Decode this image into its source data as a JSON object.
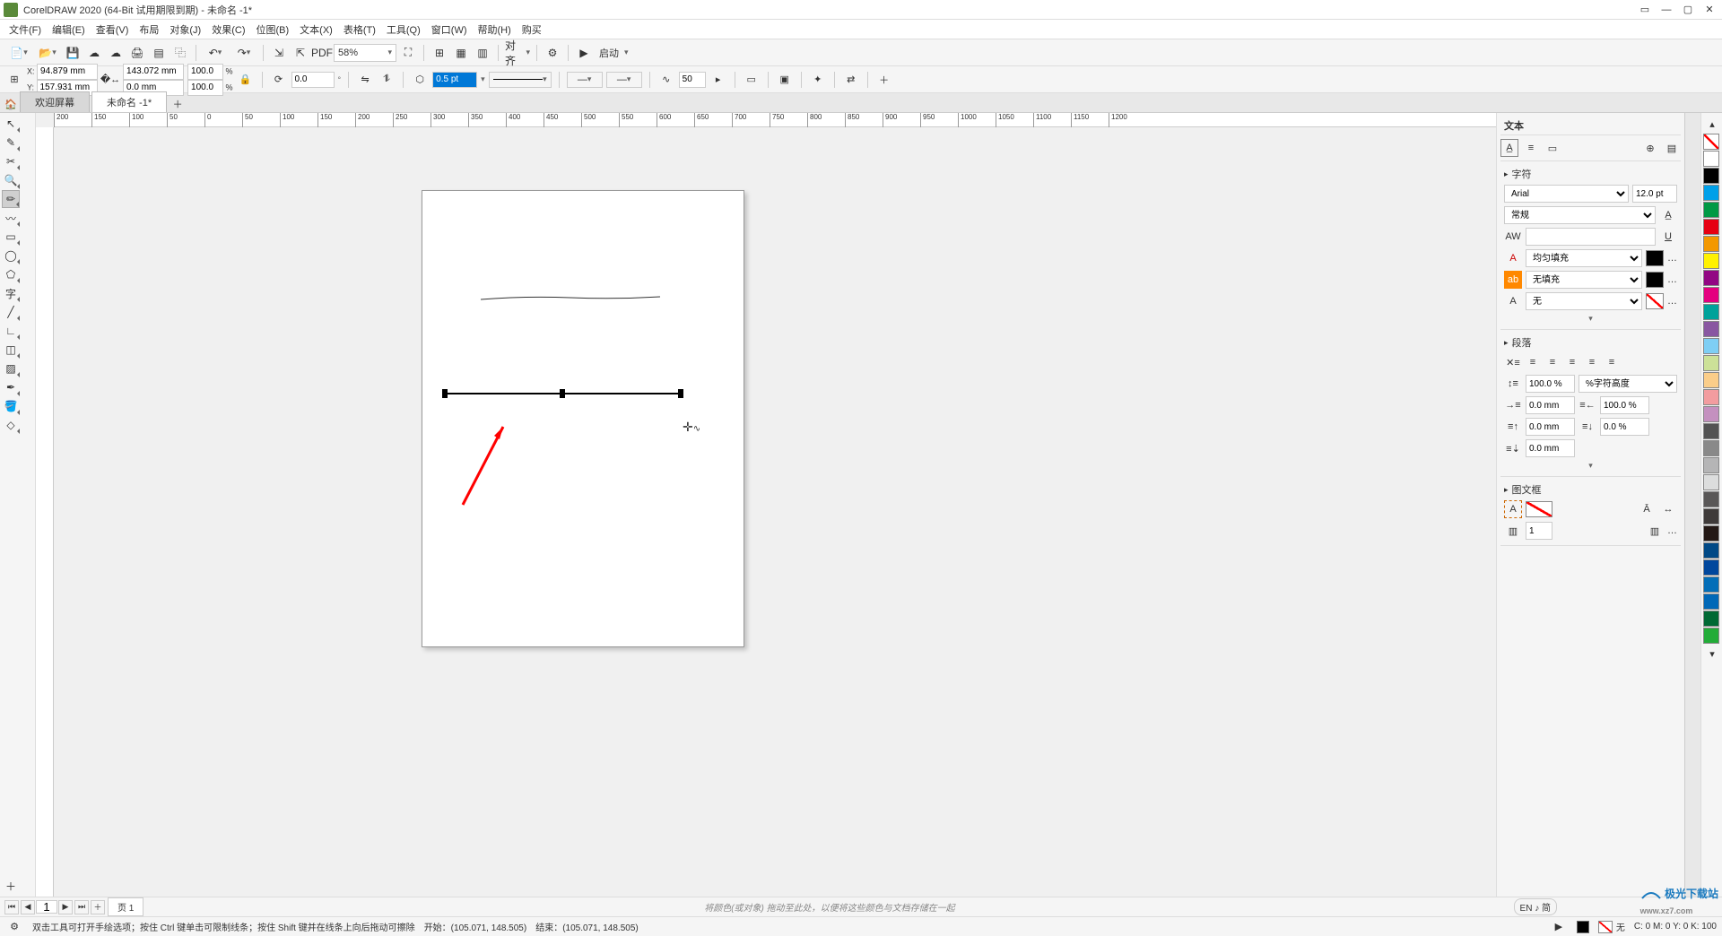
{
  "app": {
    "title": "CorelDRAW 2020 (64-Bit 试用期限到期) - 未命名 -1*"
  },
  "menu": {
    "items": [
      "文件(F)",
      "编辑(E)",
      "查看(V)",
      "布局",
      "对象(J)",
      "效果(C)",
      "位图(B)",
      "文本(X)",
      "表格(T)",
      "工具(Q)",
      "窗口(W)",
      "帮助(H)",
      "购买"
    ]
  },
  "toolbar1": {
    "zoom": "58%",
    "launch_label": "启动"
  },
  "propbar": {
    "x": "94.879 mm",
    "y": "157.931 mm",
    "w": "143.072 mm",
    "h": "0.0 mm",
    "sx": "100.0",
    "sy": "100.0",
    "rot": "0.0",
    "outline_width": "0.5 pt",
    "freehand_smoothing": "50"
  },
  "tabs": {
    "welcome": "欢迎屏幕",
    "doc": "未命名 -1*"
  },
  "ruler_ticks": [
    "200",
    "150",
    "100",
    "50",
    "0",
    "50",
    "100",
    "150",
    "200",
    "250",
    "300",
    "350",
    "400",
    "450",
    "500",
    "550",
    "600",
    "650",
    "700",
    "750",
    "800",
    "850",
    "900",
    "950",
    "1000",
    "1050",
    "1100",
    "1150",
    "1200"
  ],
  "docker": {
    "title": "文本",
    "section_char": "字符",
    "font": "Arial",
    "size": "12.0 pt",
    "style": "常规",
    "fill_label": "均匀填充",
    "nofill_label": "无填充",
    "outline_label": "无",
    "section_para": "段落",
    "line_spacing": "100.0 %",
    "char_height_label": "%字符高度",
    "left_indent": "0.0 mm",
    "first_indent": "100.0 %",
    "before": "0.0 mm",
    "after_pct": "0.0 %",
    "after_mm": "0.0 mm",
    "section_frame": "图文框",
    "columns": "1"
  },
  "palette_colors": [
    "#ffffff",
    "#000000",
    "#00a0e9",
    "#009944",
    "#e60012",
    "#f39800",
    "#fff100",
    "#920783",
    "#e4007f",
    "#00a29a",
    "#8957a1",
    "#7ecef4",
    "#cce198",
    "#facd89",
    "#f29c9f",
    "#c490bf",
    "#535353",
    "#898989",
    "#b5b5b6",
    "#dcdddd",
    "#595757",
    "#3e3a39",
    "#231815",
    "#004986",
    "#00479d",
    "#036eb8",
    "#0068b7",
    "#006934",
    "#22ac38"
  ],
  "pagebar": {
    "page": "1",
    "page_label": "页 1",
    "hint": "将颜色(或对象) 拖动至此处，以便将这些颜色与文档存储在一起",
    "lang": "EN ♪ 简"
  },
  "statusbar": {
    "hint": "双击工具可打开手绘选项；按住 Ctrl 键单击可限制线条；按住 Shift 键并在线条上向后拖动可擦除",
    "start": "开始：(105.071, 148.505)",
    "end": "结束：(105.071, 148.505)",
    "fill_label": "无",
    "cmyk": "C: 0 M: 0 Y: 0 K: 100"
  },
  "watermark": {
    "brand": "极光下载站",
    "url": "www.xz7.com"
  }
}
